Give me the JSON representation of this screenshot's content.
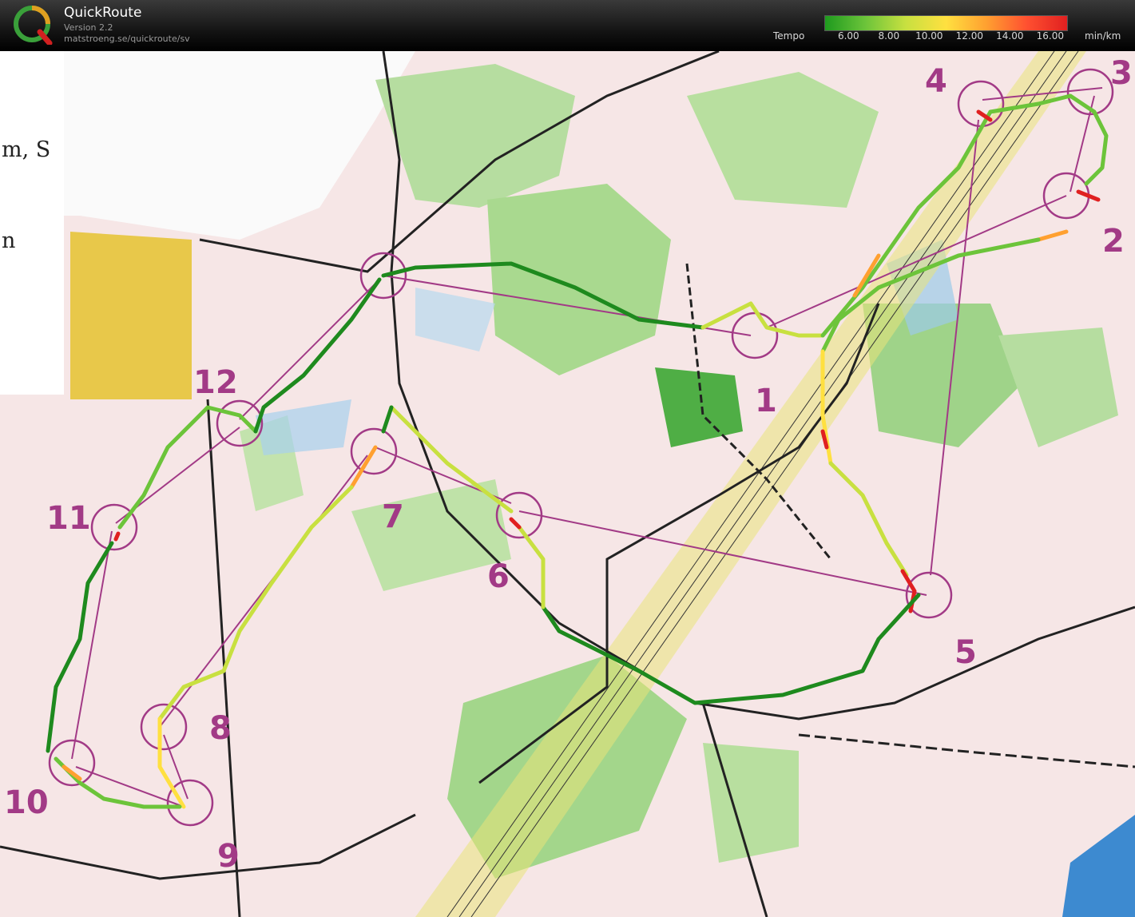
{
  "app": {
    "name": "QuickRoute",
    "version": "Version 2.2",
    "url": "matstroeng.se/quickroute/sv",
    "logo_letter": "Q"
  },
  "legend": {
    "label": "Tempo",
    "unit": "min/km",
    "ticks": [
      "6.00",
      "8.00",
      "10.00",
      "12.00",
      "14.00",
      "16.00"
    ],
    "tick_values": [
      6,
      8,
      10,
      12,
      14,
      16
    ],
    "range": [
      4.8,
      16.8
    ],
    "gradient_colors": [
      "#1e9a1e",
      "#6cc43a",
      "#c8e040",
      "#ffe040",
      "#ffa030",
      "#ff5030",
      "#e02020"
    ]
  },
  "paper": {
    "fragment_1": "m, S",
    "fragment_2": "n"
  },
  "controls": [
    {
      "number": "1"
    },
    {
      "number": "2"
    },
    {
      "number": "3"
    },
    {
      "number": "4"
    },
    {
      "number": "5"
    },
    {
      "number": "6"
    },
    {
      "number": "7"
    },
    {
      "number": "8"
    },
    {
      "number": "9"
    },
    {
      "number": "10"
    },
    {
      "number": "11"
    },
    {
      "number": "12"
    }
  ],
  "colors": {
    "course": "#a23a86",
    "fast": "#1e8a1e",
    "slow": "#e02020",
    "open_land": "#e8c84a",
    "forest_green": "#8ccf7a",
    "water": "#7ab8e0",
    "paper": "#f6e6e6"
  }
}
